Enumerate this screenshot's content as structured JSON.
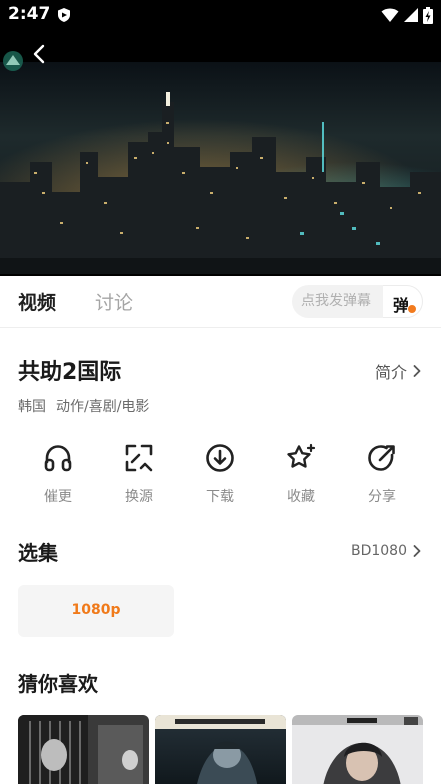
{
  "status_bar": {
    "time": "2:47",
    "icons": [
      "shield-app-icon",
      "wifi-icon",
      "cellular-signal-icon",
      "battery-charging-icon"
    ]
  },
  "player": {
    "back_icon": "chevron-left-icon",
    "logo_icon": "channel-logo-icon"
  },
  "tabs": {
    "video": "视频",
    "discuss": "讨论"
  },
  "danmu": {
    "placeholder": "点我发弹幕",
    "toggle_label": "弹",
    "accent": "#f27b1e"
  },
  "detail": {
    "title": "共助2国际",
    "intro_label": "简介",
    "region": "韩国",
    "genres": "动作/喜剧/电影"
  },
  "actions": [
    {
      "label": "催更",
      "icon": "headphones-icon"
    },
    {
      "label": "换源",
      "icon": "switch-source-icon"
    },
    {
      "label": "下载",
      "icon": "download-icon"
    },
    {
      "label": "收藏",
      "icon": "star-icon"
    },
    {
      "label": "分享",
      "icon": "share-icon"
    }
  ],
  "episodes": {
    "title": "选集",
    "source_label": "BD1080",
    "items": [
      {
        "label": "1080p",
        "color": "#f07a1a"
      }
    ]
  },
  "recommend": {
    "title": "猜你喜欢",
    "items": [
      {
        "name": "poster-1"
      },
      {
        "name": "poster-2"
      },
      {
        "name": "poster-3"
      }
    ]
  }
}
